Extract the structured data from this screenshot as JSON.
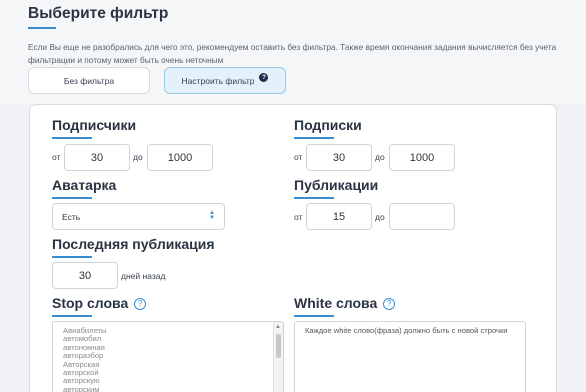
{
  "header": {
    "title": "Выберите фильтр",
    "hint": "Если Вы еще не разобрались для чего это, рекомендуем оставить без фильтра. Также время окончания задания вычисляется без учета фильтрации и потому может быть очень неточным"
  },
  "filter_mode": {
    "option_none": "Без фильтра",
    "option_custom": "Настроить фильтр",
    "selected": "Настроить фильтр"
  },
  "followers": {
    "label": "Подписчики",
    "from_label": "от",
    "from_value": "30",
    "to_label": "до",
    "to_value": "1000"
  },
  "following": {
    "label": "Подписки",
    "from_label": "от",
    "from_value": "30",
    "to_label": "до",
    "to_value": "1000"
  },
  "avatar": {
    "label": "Аватарка",
    "value": "Есть"
  },
  "posts": {
    "label": "Публикации",
    "from_label": "от",
    "from_value": "15",
    "to_label": "до",
    "to_value": ""
  },
  "last_post": {
    "label": "Последняя публикация",
    "value": "30",
    "suffix": "дней назад"
  },
  "stop_words": {
    "label": "Stop слова",
    "items": [
      "Авиабилеты",
      "автомобил",
      "автономная",
      "авторазбор",
      "Авторская",
      "авторской",
      "авторскую",
      "авторским"
    ]
  },
  "white_words": {
    "label": "White слова",
    "placeholder": "Каждое white слово(фраза) должно быть с новой строчки"
  },
  "colors": {
    "accent": "#3a8cd0",
    "selected_bg": "#e3f1fb",
    "title": "#2a3442"
  }
}
